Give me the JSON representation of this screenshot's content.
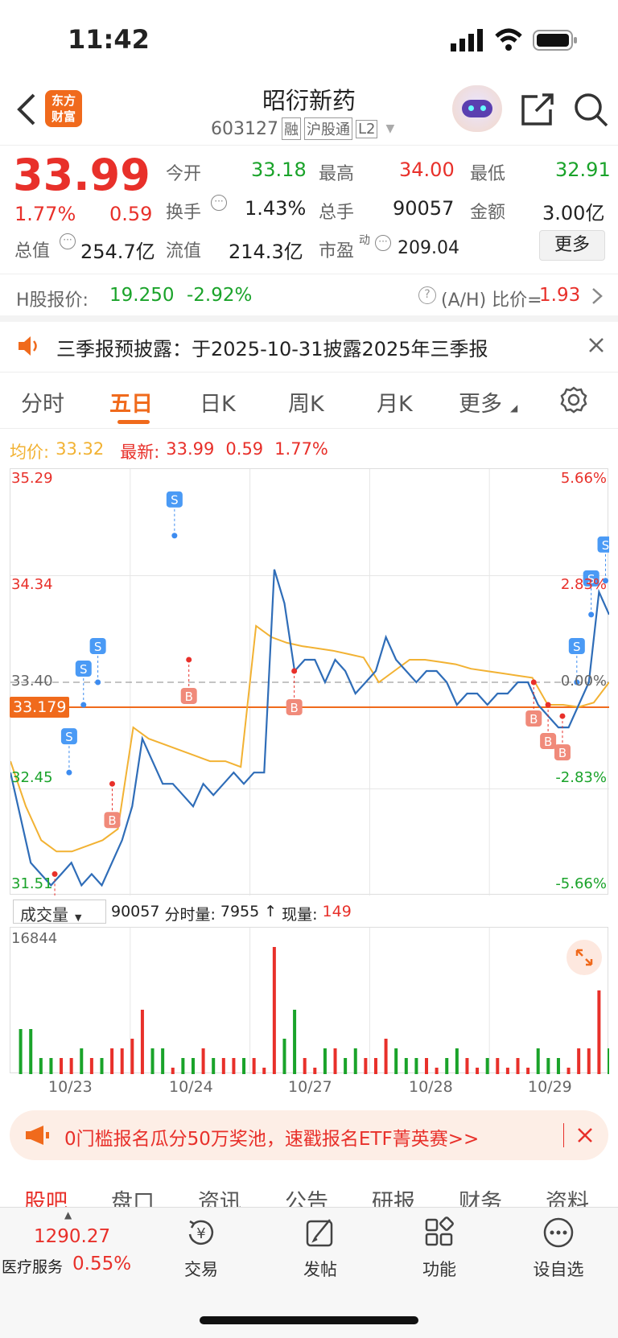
{
  "status_bar": {
    "time": "11:42"
  },
  "header": {
    "title": "昭衍新药",
    "code": "603127",
    "tags": [
      "融",
      "沪股通",
      "L2"
    ],
    "logo_line1": "东方",
    "logo_line2": "财富"
  },
  "quote": {
    "price": "33.99",
    "change_pct": "1.77%",
    "change": "0.59",
    "open_label": "今开",
    "open": "33.18",
    "high_label": "最高",
    "high": "34.00",
    "low_label": "最低",
    "low": "32.91",
    "turnover_label": "换手",
    "turnover": "1.43%",
    "volume_label": "总手",
    "volume": "90057",
    "amount_label": "金额",
    "amount": "3.00亿",
    "mcap_label": "总值",
    "mcap": "254.7亿",
    "float_label": "流值",
    "float": "214.3亿",
    "pe_label": "市盈",
    "pe_sup": "动",
    "pe": "209.04",
    "more": "更多"
  },
  "hshare": {
    "label": "H股报价:",
    "price": "19.250",
    "pct": "-2.92%",
    "ah_label": "(A/H) 比价=",
    "ah": "1.93"
  },
  "notice": {
    "text": "三季报预披露：于2025-10-31披露2025年三季报"
  },
  "chart_tabs": [
    "分时",
    "五日",
    "日K",
    "周K",
    "月K",
    "更多"
  ],
  "chart_tabs_active": 1,
  "chart_legend": {
    "avg_label": "均价:",
    "avg": "33.32",
    "last_label": "最新:",
    "last": "33.99",
    "chg": "0.59",
    "pct": "1.77%"
  },
  "chart_data": {
    "type": "line",
    "x": [
      "10/23",
      "10/24",
      "10/27",
      "10/28",
      "10/29"
    ],
    "yticks_left": [
      "35.29",
      "34.34",
      "33.40",
      "32.45",
      "31.51"
    ],
    "yticks_right": [
      "5.66%",
      "2.83%",
      "0.00%",
      "-2.83%",
      "-5.66%"
    ],
    "ylim": [
      31.51,
      35.29
    ],
    "prev_close": 33.4,
    "reference_line": "33.179",
    "series": [
      {
        "values": [
          32.6,
          32.2,
          31.8,
          31.7,
          31.6,
          31.7,
          31.8,
          31.6,
          31.7,
          31.6,
          31.8,
          32.0,
          32.3,
          32.9,
          32.7,
          32.5,
          32.5,
          32.4,
          32.3,
          32.5,
          32.4,
          32.5,
          32.6,
          32.5,
          32.6,
          32.6,
          34.4,
          34.1,
          33.5,
          33.6,
          33.6,
          33.4,
          33.6,
          33.5,
          33.3,
          33.4,
          33.5,
          33.8,
          33.6,
          33.5,
          33.4,
          33.5,
          33.5,
          33.4,
          33.2,
          33.3,
          33.3,
          33.2,
          33.3,
          33.3,
          33.4,
          33.4,
          33.2,
          33.1,
          33.0,
          33.0,
          33.2,
          33.4,
          34.2,
          34.0
        ]
      },
      {
        "values": [
          32.7,
          32.3,
          32.0,
          31.9,
          31.9,
          31.95,
          32.0,
          32.1,
          33.0,
          32.9,
          32.85,
          32.8,
          32.75,
          32.7,
          32.7,
          32.65,
          33.9,
          33.8,
          33.75,
          33.72,
          33.7,
          33.68,
          33.65,
          33.62,
          33.4,
          33.5,
          33.6,
          33.6,
          33.58,
          33.56,
          33.52,
          33.5,
          33.48,
          33.46,
          33.44,
          33.2,
          33.2,
          33.18,
          33.22,
          33.4
        ]
      }
    ],
    "trade_marks": [
      {
        "label": "B",
        "x_day": 0,
        "price": 31.7
      },
      {
        "label": "S",
        "x_day": 0,
        "price": 32.6
      },
      {
        "label": "S",
        "x_day": 0,
        "price": 33.2
      },
      {
        "label": "S",
        "x_day": 0,
        "price": 33.4
      },
      {
        "label": "B",
        "x_day": 0,
        "price": 32.5
      },
      {
        "label": "S",
        "x_day": 1,
        "price": 34.7
      },
      {
        "label": "B",
        "x_day": 1,
        "price": 33.6
      },
      {
        "label": "B",
        "x_day": 2,
        "price": 33.5
      },
      {
        "label": "B",
        "x_day": 4,
        "price": 33.4
      },
      {
        "label": "B",
        "x_day": 4,
        "price": 33.2
      },
      {
        "label": "B",
        "x_day": 4,
        "price": 33.1
      },
      {
        "label": "S",
        "x_day": 4,
        "price": 33.4
      },
      {
        "label": "S",
        "x_day": 4,
        "price": 34.0
      },
      {
        "label": "S",
        "x_day": 4,
        "price": 34.3
      },
      {
        "label": "S",
        "x_day": 4,
        "price": 34.5
      }
    ],
    "volume": {
      "label": "成交量",
      "total": "90057",
      "bar_label": "分时量:",
      "bar": "7955",
      "now_label": "现量:",
      "now": "149",
      "max": "16844"
    }
  },
  "promo": {
    "text": "0门槛报名瓜分50万奖池，速戳报名ETF菁英赛>>"
  },
  "sub_tabs": [
    "股吧",
    "盘口",
    "资讯",
    "公告",
    "研报",
    "财务",
    "资料"
  ],
  "bottom": {
    "index_value": "1290.27",
    "index_name": "医疗服务",
    "index_pct": "0.55%",
    "nav": [
      "交易",
      "发帖",
      "功能",
      "设自选"
    ]
  },
  "colors": {
    "up": "#e8302a",
    "down": "#1aa32a",
    "line": "#2f6db8",
    "avg": "#f2b233",
    "accent": "#f06a1c"
  }
}
